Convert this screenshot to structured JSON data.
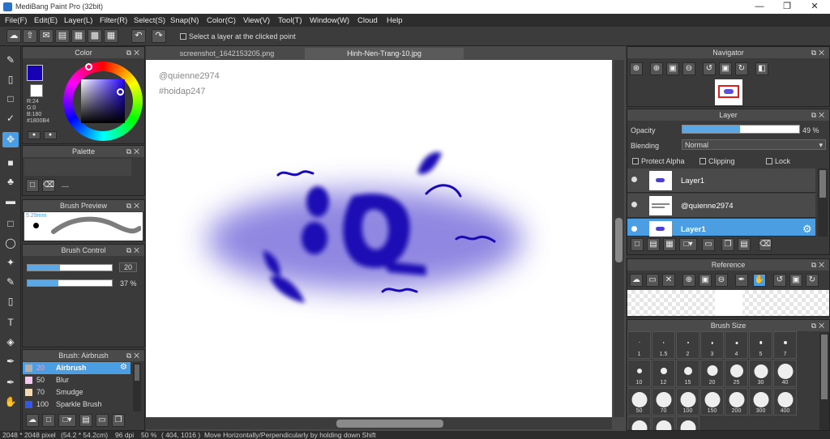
{
  "window": {
    "title": "MediBang Paint Pro (32bit)"
  },
  "menu": [
    "File(F)",
    "Edit(E)",
    "Layer(L)",
    "Filter(R)",
    "Select(S)",
    "Snap(N)",
    "Color(C)",
    "View(V)",
    "Tool(T)",
    "Window(W)",
    "Cloud",
    "Help"
  ],
  "toolbar": {
    "select_layer_label": "Select a layer at the clicked point"
  },
  "color_panel": {
    "title": "Color",
    "r": "R:24",
    "g": "G:0",
    "b": "B:180",
    "hex": "#1800B4",
    "primary": "#1800b4",
    "secondary": "#ffffff"
  },
  "palette_panel": {
    "title": "Palette",
    "empty_text": "---"
  },
  "brush_preview": {
    "title": "Brush Preview",
    "size": "5.29mm"
  },
  "brush_control": {
    "title": "Brush Control",
    "size_value": "20",
    "opacity_value": "37",
    "opacity_unit": "%",
    "size_fill": 0.38,
    "opacity_fill": 0.37
  },
  "brush_list": {
    "title": "Brush: Airbrush",
    "items": [
      {
        "size": "20",
        "name": "Airbrush",
        "color": "#b0b0b0"
      },
      {
        "size": "50",
        "name": "Blur",
        "color": "#f7c6f3"
      },
      {
        "size": "70",
        "name": "Smudge",
        "color": "#f4d8b3"
      },
      {
        "size": "100",
        "name": "Sparkle Brush",
        "color": "#3457e8"
      }
    ]
  },
  "tabs": [
    "screenshot_1642153205.png",
    "Hinh-Nen-Trang-10.jpg"
  ],
  "canvas_text": {
    "line1": "@quienne2974",
    "line2": "#hoidap247"
  },
  "navigator": {
    "title": "Navigator"
  },
  "layer_panel": {
    "title": "Layer",
    "opacity_label": "Opacity",
    "opacity_value": "49",
    "opacity_unit": "%",
    "opacity_fill": 0.49,
    "blending_label": "Blending",
    "blending_value": "Normal",
    "protect_alpha": "Protect Alpha",
    "clipping": "Clipping",
    "lock": "Lock",
    "layers": [
      {
        "name": "Layer1",
        "selected": false
      },
      {
        "name": "@quienne2974",
        "selected": false
      },
      {
        "name": "Layer1",
        "selected": true
      }
    ]
  },
  "reference_panel": {
    "title": "Reference"
  },
  "brush_size_panel": {
    "title": "Brush Size",
    "sizes": [
      "1",
      "1.5",
      "2",
      "3",
      "4",
      "5",
      "7",
      "10",
      "12",
      "15",
      "20",
      "25",
      "30",
      "40",
      "50",
      "70",
      "100",
      "150",
      "200",
      "300",
      "400"
    ]
  },
  "status": {
    "dimensions": "2048 * 2048 pixel",
    "physical": "(54.2 * 54.2cm)",
    "dpi": "96 dpi",
    "zoom": "50 %",
    "coords": "( 404, 1016 )",
    "hint": "Move Horizontally/Perpendicularly by holding down Shift"
  }
}
